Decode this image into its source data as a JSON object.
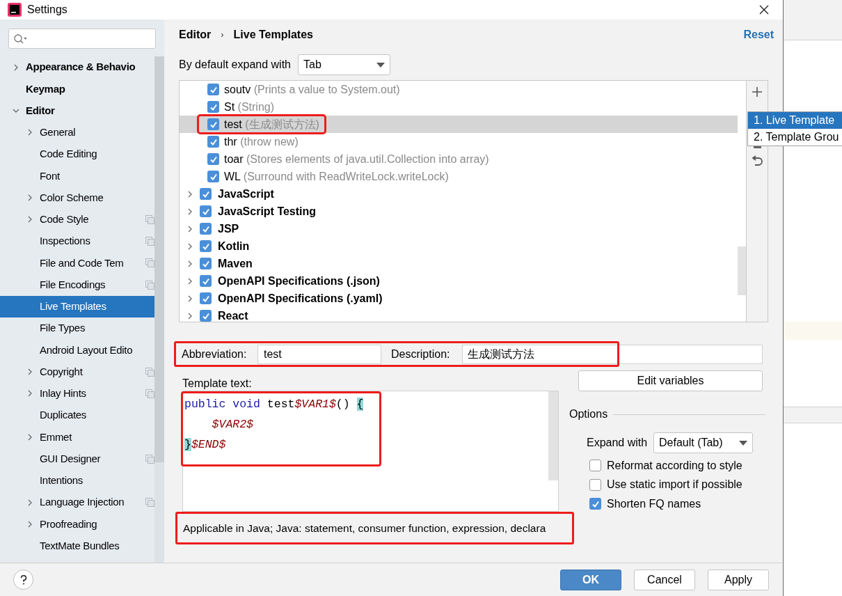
{
  "window": {
    "title": "Settings"
  },
  "sidebar": {
    "items": [
      {
        "label": "Appearance & Behavio",
        "bold": true,
        "expandable": true,
        "expanded": false,
        "shared": false,
        "selected": false
      },
      {
        "label": "Keymap",
        "bold": true,
        "expandable": false,
        "shared": false,
        "selected": false
      },
      {
        "label": "Editor",
        "bold": true,
        "expandable": true,
        "expanded": true,
        "shared": false,
        "selected": false,
        "children": [
          {
            "label": "General",
            "expandable": true,
            "expanded": false,
            "shared": false,
            "selected": false
          },
          {
            "label": "Code Editing",
            "expandable": false,
            "shared": false,
            "selected": false
          },
          {
            "label": "Font",
            "expandable": false,
            "shared": false,
            "selected": false
          },
          {
            "label": "Color Scheme",
            "expandable": true,
            "expanded": false,
            "shared": false,
            "selected": false
          },
          {
            "label": "Code Style",
            "expandable": true,
            "expanded": false,
            "shared": true,
            "selected": false
          },
          {
            "label": "Inspections",
            "expandable": false,
            "shared": true,
            "selected": false
          },
          {
            "label": "File and Code Tem",
            "expandable": false,
            "shared": true,
            "selected": false
          },
          {
            "label": "File Encodings",
            "expandable": false,
            "shared": true,
            "selected": false
          },
          {
            "label": "Live Templates",
            "expandable": false,
            "shared": false,
            "selected": true
          },
          {
            "label": "File Types",
            "expandable": false,
            "shared": false,
            "selected": false
          },
          {
            "label": "Android Layout Edito",
            "expandable": false,
            "shared": false,
            "selected": false
          },
          {
            "label": "Copyright",
            "expandable": true,
            "expanded": false,
            "shared": true,
            "selected": false
          },
          {
            "label": "Inlay Hints",
            "expandable": true,
            "expanded": false,
            "shared": true,
            "selected": false
          },
          {
            "label": "Duplicates",
            "expandable": false,
            "shared": false,
            "selected": false
          },
          {
            "label": "Emmet",
            "expandable": true,
            "expanded": false,
            "shared": false,
            "selected": false
          },
          {
            "label": "GUI Designer",
            "expandable": false,
            "shared": true,
            "selected": false
          },
          {
            "label": "Intentions",
            "expandable": false,
            "shared": false,
            "selected": false
          },
          {
            "label": "Language Injection",
            "expandable": true,
            "expanded": false,
            "shared": true,
            "selected": false
          },
          {
            "label": "Proofreading",
            "expandable": true,
            "expanded": false,
            "shared": false,
            "selected": false
          },
          {
            "label": "TextMate Bundles",
            "expandable": false,
            "shared": false,
            "selected": false
          }
        ]
      }
    ]
  },
  "breadcrumb": [
    "Editor",
    "›",
    "Live Templates"
  ],
  "reset": "Reset",
  "expand_default": {
    "label": "By default expand with",
    "value": "Tab"
  },
  "templates": [
    {
      "kind": "template",
      "abbr": "soutv",
      "description": "(Prints a value to System.out)",
      "checked": true,
      "selected": false,
      "highlighted": false
    },
    {
      "kind": "template",
      "abbr": "St",
      "description": "(String)",
      "checked": true,
      "selected": false,
      "highlighted": false
    },
    {
      "kind": "template",
      "abbr": "test",
      "description": "(生成测试方法)",
      "checked": true,
      "selected": true,
      "highlighted": true
    },
    {
      "kind": "template",
      "abbr": "thr",
      "description": "(throw new)",
      "checked": true,
      "selected": false,
      "highlighted": false
    },
    {
      "kind": "template",
      "abbr": "toar",
      "description": "(Stores elements of java.util.Collection into array)",
      "checked": true,
      "selected": false,
      "highlighted": false
    },
    {
      "kind": "template",
      "abbr": "WL",
      "description": "(Surround with ReadWriteLock.writeLock)",
      "checked": true,
      "selected": false,
      "highlighted": false
    },
    {
      "kind": "group",
      "name": "JavaScript",
      "checked": true,
      "expanded": false
    },
    {
      "kind": "group",
      "name": "JavaScript Testing",
      "checked": true,
      "expanded": false
    },
    {
      "kind": "group",
      "name": "JSP",
      "checked": true,
      "expanded": false
    },
    {
      "kind": "group",
      "name": "Kotlin",
      "checked": true,
      "expanded": false
    },
    {
      "kind": "group",
      "name": "Maven",
      "checked": true,
      "expanded": false
    },
    {
      "kind": "group",
      "name": "OpenAPI Specifications (.json)",
      "checked": true,
      "expanded": false
    },
    {
      "kind": "group",
      "name": "OpenAPI Specifications (.yaml)",
      "checked": true,
      "expanded": false
    },
    {
      "kind": "group",
      "name": "React",
      "checked": true,
      "expanded": false
    }
  ],
  "add_menu": [
    {
      "label": "1. Live Template",
      "selected": true
    },
    {
      "label": "2. Template Grou",
      "selected": false
    }
  ],
  "fields": {
    "highlighted": true,
    "abbreviation_label": "Abbreviation:",
    "abbreviation": "test",
    "description_label": "Description:",
    "description": "生成测试方法"
  },
  "template_text": {
    "label": "Template text:",
    "highlighted": true,
    "lines": [
      [
        {
          "kind": "keyword",
          "text": "public void"
        },
        {
          "kind": "plain",
          "text": " test"
        },
        {
          "kind": "variable",
          "text": "$VAR1$"
        },
        {
          "kind": "plain",
          "text": "() "
        },
        {
          "kind": "brace",
          "text": "{"
        }
      ],
      [
        {
          "kind": "variable",
          "text": "    $VAR2$"
        }
      ],
      [
        {
          "kind": "brace",
          "text": "}"
        },
        {
          "kind": "variable",
          "text": "$END$"
        }
      ]
    ]
  },
  "applicable": {
    "text": "Applicable in Java; Java: statement, consumer function, expression, declara",
    "highlighted": true
  },
  "edit_variables": "Edit variables",
  "options": {
    "title": "Options",
    "expand_label": "Expand with",
    "expand_value": "Default (Tab)",
    "checkboxes": [
      {
        "label": "Reformat according to style",
        "checked": false
      },
      {
        "label": "Use static import if possible",
        "checked": false
      },
      {
        "label": "Shorten FQ names",
        "checked": true
      }
    ]
  },
  "buttons": [
    {
      "label": "OK",
      "kind": "primary"
    },
    {
      "label": "Cancel",
      "kind": "default"
    },
    {
      "label": "Apply",
      "kind": "default"
    }
  ]
}
